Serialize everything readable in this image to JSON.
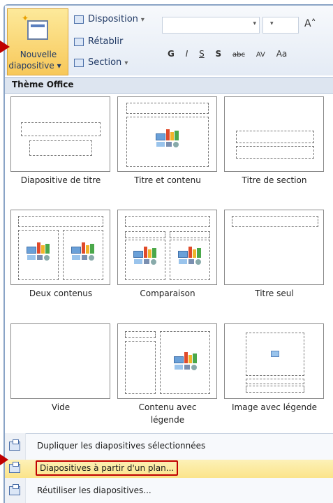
{
  "ribbon": {
    "new_slide_label_line1": "Nouvelle",
    "new_slide_label_line2": "diapositive",
    "new_slide_caret": "▾",
    "layout_label": "Disposition",
    "reset_label": "Rétablir",
    "section_label": "Section",
    "caret": "▾",
    "font_grow": "A˄",
    "format_buttons": [
      "G",
      "I",
      "S",
      "S",
      "abc",
      "AV",
      "Aa"
    ]
  },
  "gallery": {
    "header": "Thème Office",
    "layouts": [
      {
        "label": "Diapositive de titre"
      },
      {
        "label": "Titre et contenu"
      },
      {
        "label": "Titre de section"
      },
      {
        "label": "Deux contenus"
      },
      {
        "label": "Comparaison"
      },
      {
        "label": "Titre seul"
      },
      {
        "label": "Vide"
      },
      {
        "label_line1": "Contenu avec",
        "label_line2": "légende"
      },
      {
        "label": "Image avec légende"
      }
    ]
  },
  "menu": {
    "items": [
      {
        "label": "Dupliquer les diapositives sélectionnées"
      },
      {
        "label": "Diapositives à partir d'un plan..."
      },
      {
        "label": "Réutiliser les diapositives..."
      }
    ]
  },
  "colors": {
    "highlight": "#fbe48a",
    "annotation_red": "#c00000",
    "ribbon_bg": "#e4ebf5"
  }
}
